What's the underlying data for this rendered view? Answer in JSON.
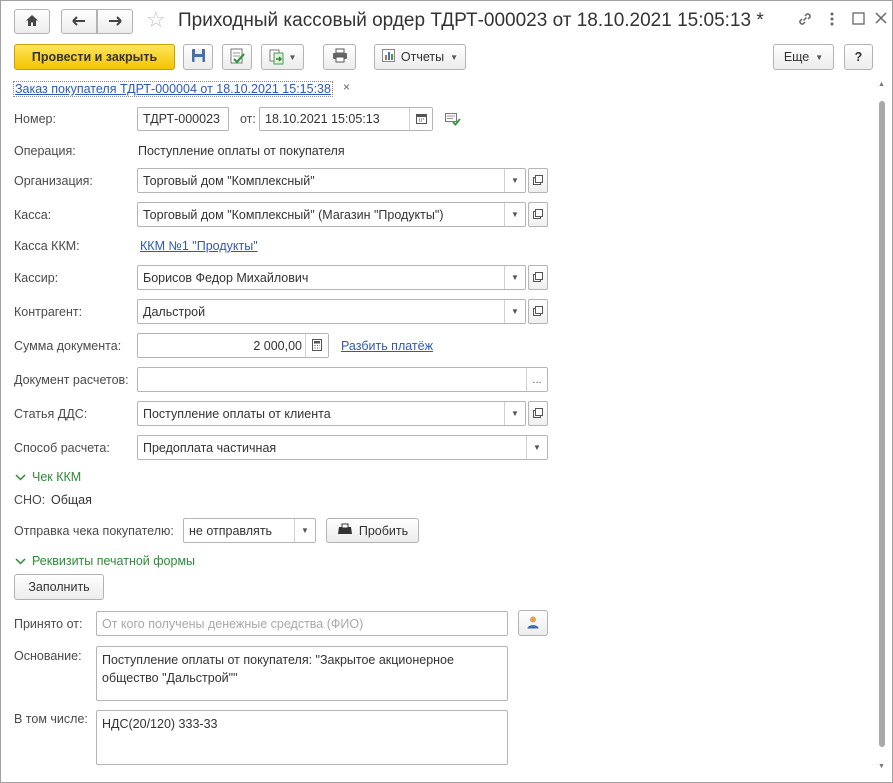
{
  "window": {
    "title": "Приходный кассовый ордер ТДРТ-000023 от 18.10.2021 15:05:13 *"
  },
  "toolbar": {
    "post_close_label": "Провести и закрыть",
    "reports_label": "Отчеты",
    "more_label": "Еще",
    "help_label": "?"
  },
  "basis_link": "Заказ покупателя ТДРТ-000004 от 18.10.2021 15:15:38",
  "form": {
    "number_label": "Номер:",
    "number_value": "ТДРТ-000023",
    "date_label": "от:",
    "date_value": "18.10.2021 15:05:13",
    "operation_label": "Операция:",
    "operation_value": "Поступление оплаты от покупателя",
    "organization_label": "Организация:",
    "organization_value": "Торговый дом \"Комплексный\"",
    "cashbox_label": "Касса:",
    "cashbox_value": "Торговый дом \"Комплексный\" (Магазин \"Продукты\")",
    "kkm_label": "Касса ККМ:",
    "kkm_value": "ККМ №1 \"Продукты\"",
    "cashier_label": "Кассир:",
    "cashier_value": "Борисов Федор Михайлович",
    "counterparty_label": "Контрагент:",
    "counterparty_value": "Дальстрой",
    "amount_label": "Сумма документа:",
    "amount_value": "2 000,00",
    "split_payment_link": "Разбить платёж",
    "settlement_doc_label": "Документ расчетов:",
    "settlement_doc_value": "",
    "dds_label": "Статья ДДС:",
    "dds_value": "Поступление оплаты от клиента",
    "payment_method_label": "Способ расчета:",
    "payment_method_value": "Предоплата частичная"
  },
  "receipt_group": {
    "title": "Чек ККМ",
    "sno_label": "СНО:",
    "sno_value": "Общая",
    "send_label": "Отправка чека покупателю:",
    "send_value": "не отправлять",
    "punch_label": "Пробить"
  },
  "print_group": {
    "title": "Реквизиты печатной формы",
    "fill_label": "Заполнить",
    "received_from_label": "Принято от:",
    "received_from_placeholder": "От кого получены денежные средства (ФИО)",
    "basis_label": "Основание:",
    "basis_value": "Поступление оплаты от покупателя: \"Закрытое акционерное общество \"Дальстрой\"\"",
    "including_label": "В том числе:",
    "including_value": "НДС(20/120) 333-33"
  },
  "icons": {
    "home": "home-icon",
    "back": "arrow-left-icon",
    "forward": "arrow-right-icon",
    "favorite": "star-icon",
    "link": "link-icon",
    "menu": "more-vertical-icon",
    "maximize": "maximize-icon",
    "close": "close-icon",
    "save": "save-icon",
    "post": "post-document-icon",
    "create_based": "create-based-on-icon",
    "print": "printer-icon",
    "reports": "report-icon",
    "calendar": "calendar-icon",
    "calculator": "calculator-icon",
    "punch": "cash-register-icon",
    "person": "person-icon"
  },
  "colors": {
    "primary_button": "#f5c400",
    "link": "#2d5bb3",
    "group_header": "#2f8a3a"
  }
}
